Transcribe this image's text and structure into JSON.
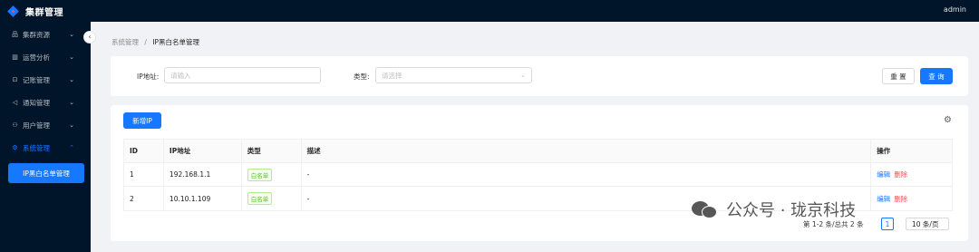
{
  "app": {
    "title": "集群管理",
    "user": "admin"
  },
  "sidebar": {
    "collapse_glyph": "‹",
    "items": [
      {
        "label": "集群资源",
        "icon": "server-icon",
        "glyph": "品"
      },
      {
        "label": "运营分析",
        "icon": "chart-icon",
        "glyph": "▥"
      },
      {
        "label": "记账管理",
        "icon": "ledger-icon",
        "glyph": "⊡"
      },
      {
        "label": "通知管理",
        "icon": "megaphone-icon",
        "glyph": "◁"
      },
      {
        "label": "用户管理",
        "icon": "user-icon",
        "glyph": "⚇"
      },
      {
        "label": "系统管理",
        "icon": "gear-icon",
        "glyph": "⚙",
        "active": true
      }
    ],
    "submenu_active": "IP黑白名单管理"
  },
  "breadcrumb": {
    "parent": "系统管理",
    "separator": "/",
    "current": "IP黑白名单管理"
  },
  "search": {
    "ip_label": "IP地址:",
    "ip_placeholder": "请输入",
    "type_label": "类型:",
    "type_placeholder": "请选择",
    "reset_label": "重 置",
    "query_label": "查 询"
  },
  "table": {
    "add_label": "新增IP",
    "columns": [
      "ID",
      "IP地址",
      "类型",
      "描述",
      "操作"
    ],
    "rows": [
      {
        "id": "1",
        "ip": "192.168.1.1",
        "type": "白名单",
        "desc": "-",
        "edit": "编辑",
        "delete": "删除"
      },
      {
        "id": "2",
        "ip": "10.10.1.109",
        "type": "白名单",
        "desc": "-",
        "edit": "编辑",
        "delete": "删除"
      }
    ]
  },
  "pagination": {
    "summary": "第 1-2 条/总共 2 条",
    "current_page": "1",
    "page_size": "10 条/页"
  },
  "watermark": {
    "text": "公众号 · 珑京科技"
  },
  "colors": {
    "primary": "#1677ff",
    "sider": "#001529",
    "danger": "#ff4d4f",
    "success": "#52c41a"
  }
}
